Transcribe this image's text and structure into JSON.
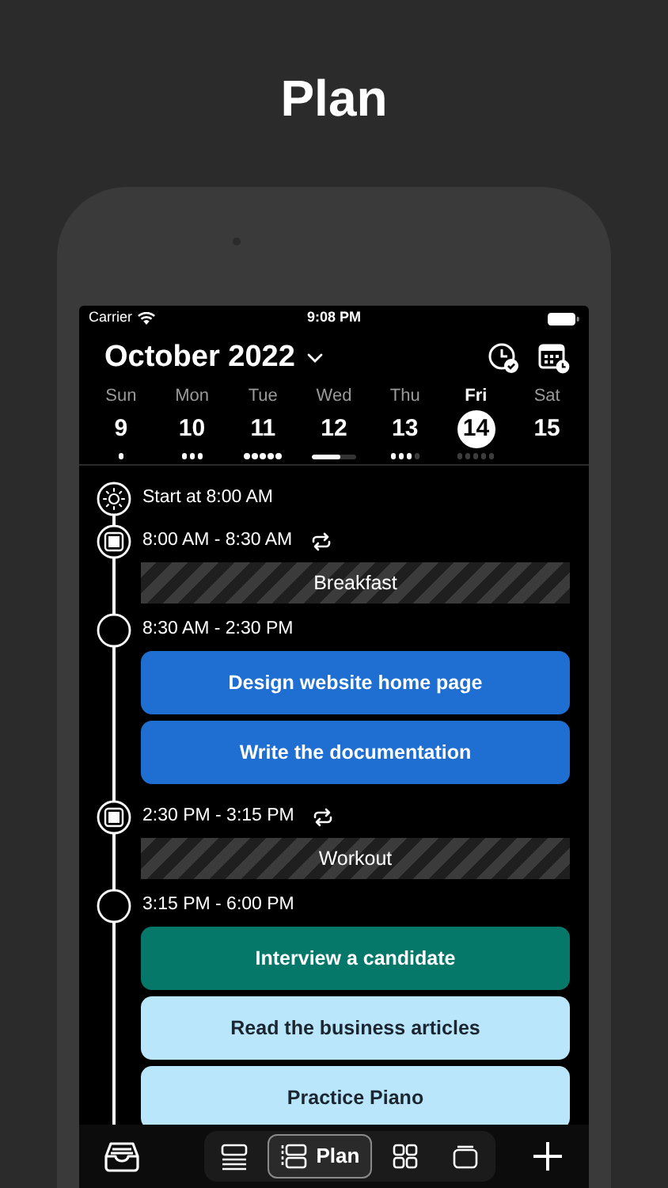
{
  "headline": "Plan",
  "status_bar": {
    "carrier": "Carrier",
    "time": "9:08 PM"
  },
  "header": {
    "month": "October 2022"
  },
  "days": [
    {
      "weekday": "Sun",
      "date": "9",
      "selected": false,
      "kind": "dots",
      "marks": [
        {
          "done": true
        }
      ]
    },
    {
      "weekday": "Mon",
      "date": "10",
      "selected": false,
      "kind": "dots",
      "marks": [
        {
          "done": true
        },
        {
          "done": true
        },
        {
          "done": true
        }
      ]
    },
    {
      "weekday": "Tue",
      "date": "11",
      "selected": false,
      "kind": "dots",
      "marks": [
        {
          "done": true
        },
        {
          "done": true
        },
        {
          "done": true
        },
        {
          "done": true
        },
        {
          "done": true
        }
      ]
    },
    {
      "weekday": "Wed",
      "date": "12",
      "selected": false,
      "kind": "bar",
      "level": 0.65
    },
    {
      "weekday": "Thu",
      "date": "13",
      "selected": false,
      "kind": "dots",
      "marks": [
        {
          "done": true
        },
        {
          "done": true
        },
        {
          "done": true
        },
        {
          "done": false
        }
      ]
    },
    {
      "weekday": "Fri",
      "date": "14",
      "selected": true,
      "kind": "dots",
      "marks": [
        {
          "done": false
        },
        {
          "done": false
        },
        {
          "done": false
        },
        {
          "done": false
        },
        {
          "done": false
        }
      ]
    },
    {
      "weekday": "Sat",
      "date": "15",
      "selected": false,
      "kind": "dots"
    }
  ],
  "timeline": [
    {
      "kind": "start",
      "label": "Start at 8:00 AM"
    },
    {
      "kind": "routine",
      "time": "8:00 AM - 8:30 AM",
      "repeat": true,
      "block": "Breakfast"
    },
    {
      "kind": "slot",
      "time": "8:30 AM - 2:30 PM",
      "tasks": [
        {
          "title": "Design website home page",
          "color": "#1f6fd3"
        },
        {
          "title": "Write the documentation",
          "color": "#1f6fd3"
        }
      ]
    },
    {
      "kind": "routine",
      "time": "2:30 PM - 3:15 PM",
      "repeat": true,
      "block": "Workout"
    },
    {
      "kind": "slot",
      "time": "3:15 PM - 6:00 PM",
      "tasks": [
        {
          "title": "Interview a candidate",
          "color": "#06786a"
        },
        {
          "title": "Read the business articles",
          "color": "#b9e6fb"
        },
        {
          "title": "Practice Piano",
          "color": "#b9e6fb"
        }
      ]
    }
  ],
  "tab_bar": {
    "tabs": [
      {
        "kind": "list",
        "selected": false
      },
      {
        "kind": "plan",
        "label": "Plan",
        "selected": true
      },
      {
        "kind": "grid",
        "selected": false
      },
      {
        "kind": "stack",
        "selected": false
      }
    ]
  }
}
